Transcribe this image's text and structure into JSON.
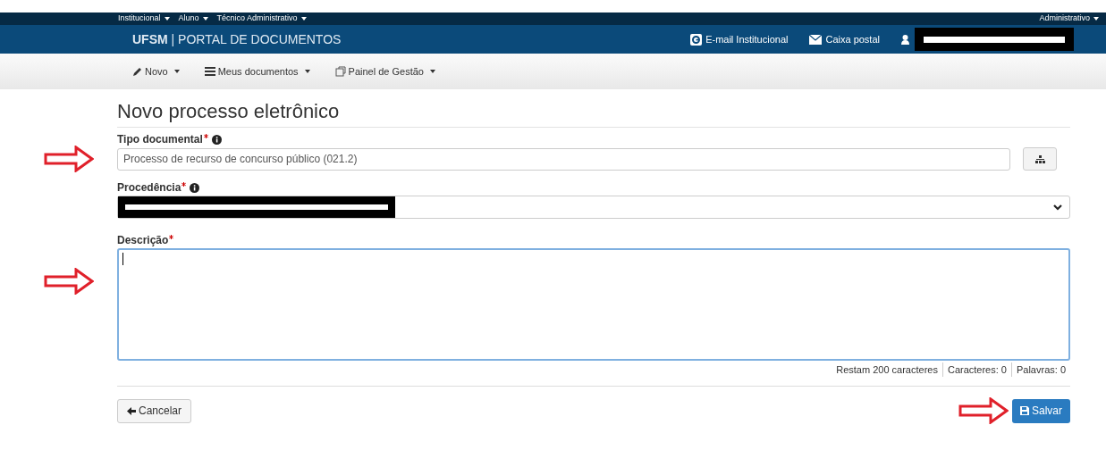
{
  "top_bar": {
    "menus": [
      "Institucional",
      "Aluno",
      "Técnico Administrativo"
    ],
    "right_menu": "Administrativo"
  },
  "header": {
    "brand": "UFSM",
    "separator": "|",
    "title": "PORTAL DE DOCUMENTOS",
    "links": [
      {
        "kind": "email",
        "label": "E-mail Institucional"
      },
      {
        "kind": "mail",
        "label": "Caixa postal"
      }
    ]
  },
  "menu_bar": [
    {
      "kind": "pencil",
      "label": "Novo"
    },
    {
      "kind": "list",
      "label": "Meus documentos"
    },
    {
      "kind": "panel",
      "label": "Painel de Gestão"
    }
  ],
  "form": {
    "title": "Novo processo eletrônico",
    "fields": [
      {
        "kind": "text",
        "label": "Tipo documental",
        "required": true,
        "info": true,
        "value": "Processo de recurso de concurso público (021.2)"
      },
      {
        "kind": "select",
        "label": "Procedência",
        "required": true,
        "info": true
      },
      {
        "kind": "textarea",
        "label": "Descrição",
        "required": true,
        "info": false
      }
    ],
    "counters": [
      "Restam 200 caracteres",
      "Caracteres: 0",
      "Palavras: 0"
    ],
    "cancel": "Cancelar",
    "save": "Salvar"
  }
}
